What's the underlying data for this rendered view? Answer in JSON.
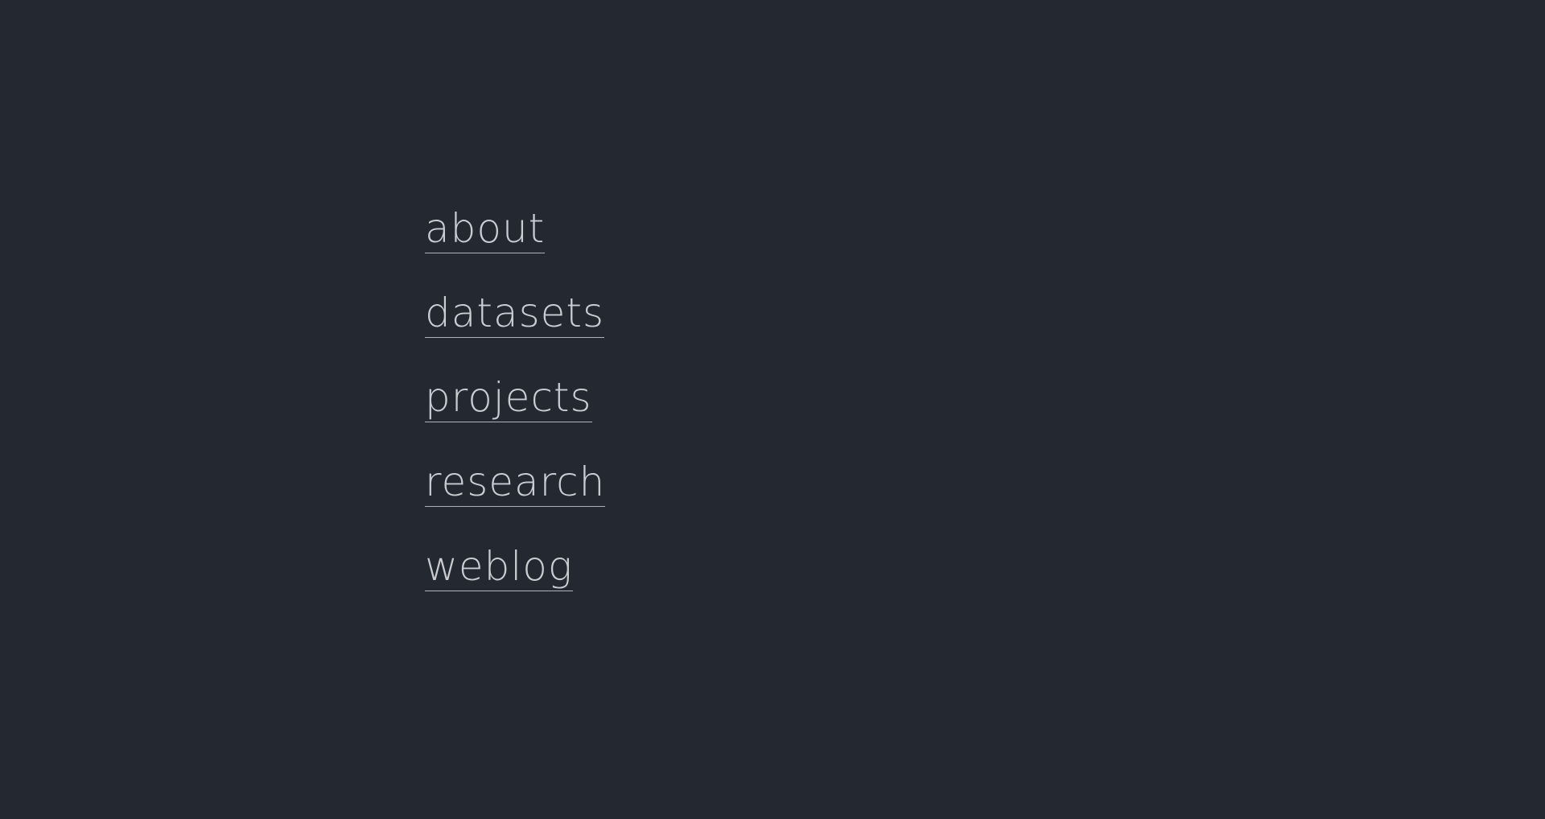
{
  "theme": {
    "background": "#232831",
    "link_color": "#c9cdd2",
    "underline_color": "#aeb3ba"
  },
  "nav": {
    "items": [
      {
        "label": "about"
      },
      {
        "label": "datasets"
      },
      {
        "label": "projects"
      },
      {
        "label": "research"
      },
      {
        "label": "weblog"
      }
    ]
  }
}
